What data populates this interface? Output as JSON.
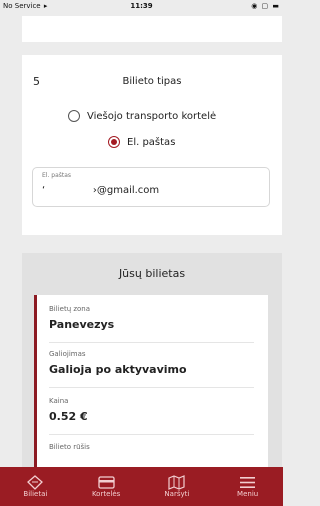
{
  "status_bar": {
    "carrier": "No Service",
    "time": "11:39",
    "right_icons": "◉ ▢ ▬"
  },
  "form": {
    "step_number": "5",
    "title": "Bilieto tipas",
    "options": [
      {
        "label": "Viešojo transporto kortelė",
        "selected": false
      },
      {
        "label": "El. paštas",
        "selected": true
      }
    ],
    "email_field": {
      "label": "El. paštas",
      "value": "‘               ›@gmail.com"
    }
  },
  "ticket": {
    "title": "Jūsų bilietas",
    "accent_color": "#8c1a22",
    "items": [
      {
        "label": "Bilietų zona",
        "value": "Panevezys"
      },
      {
        "label": "Galiojimas",
        "value": "Galioja po aktyvavimo"
      },
      {
        "label": "Kaina",
        "value": "0.52 €"
      },
      {
        "label": "Bilieto rūšis",
        "value": ""
      }
    ]
  },
  "bottom_nav": {
    "background": "#9a1c23",
    "items": [
      {
        "label": "Bilietai",
        "icon": "ticket-icon"
      },
      {
        "label": "Kortelės",
        "icon": "card-icon"
      },
      {
        "label": "Naršyti",
        "icon": "map-icon"
      },
      {
        "label": "Meniu",
        "icon": "menu-icon"
      }
    ]
  }
}
